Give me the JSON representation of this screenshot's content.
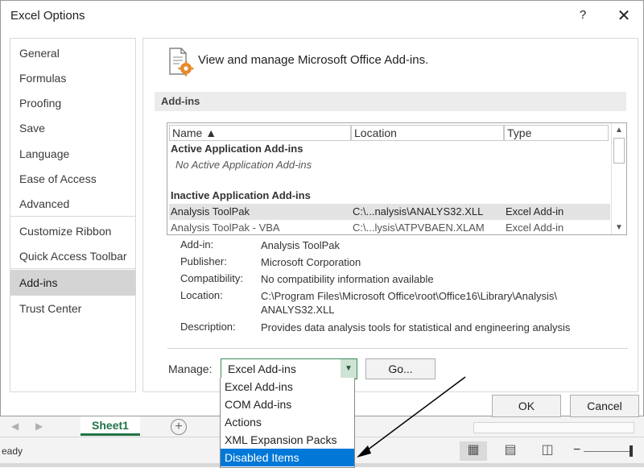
{
  "window": {
    "title": "Excel Options",
    "help": "?",
    "close": "✕"
  },
  "sidebar": {
    "items": [
      {
        "label": "General"
      },
      {
        "label": "Formulas"
      },
      {
        "label": "Proofing"
      },
      {
        "label": "Save"
      },
      {
        "label": "Language"
      },
      {
        "label": "Ease of Access"
      },
      {
        "label": "Advanced"
      },
      {
        "label": "Customize Ribbon"
      },
      {
        "label": "Quick Access Toolbar"
      },
      {
        "label": "Add-ins"
      },
      {
        "label": "Trust Center"
      }
    ],
    "selected": "Add-ins"
  },
  "main": {
    "header_text": "View and manage Microsoft Office Add-ins.",
    "section_title": "Add-ins",
    "columns": {
      "name": "Name ▲",
      "location": "Location",
      "type": "Type"
    },
    "groups": {
      "active_title": "Active Application Add-ins",
      "active_empty": "No Active Application Add-ins",
      "inactive_title": "Inactive Application Add-ins"
    },
    "rows": [
      {
        "name": "Analysis ToolPak",
        "location": "C:\\...nalysis\\ANALYS32.XLL",
        "type": "Excel Add-in"
      },
      {
        "name": "Analysis ToolPak - VBA",
        "location": "C:\\...lysis\\ATPVBAEN.XLAM",
        "type": "Excel Add-in"
      }
    ],
    "details": {
      "addin_label": "Add-in:",
      "addin_value": "Analysis ToolPak",
      "publisher_label": "Publisher:",
      "publisher_value": "Microsoft Corporation",
      "compat_label": "Compatibility:",
      "compat_value": "No compatibility information available",
      "location_label": "Location:",
      "location_value_1": "C:\\Program Files\\Microsoft Office\\root\\Office16\\Library\\Analysis\\",
      "location_value_2": "ANALYS32.XLL",
      "description_label": "Description:",
      "description_value": "Provides data analysis tools for statistical and engineering analysis"
    },
    "manage": {
      "label": "Manage:",
      "selected": "Excel Add-ins",
      "go_label": "Go...",
      "options": [
        "Excel Add-ins",
        "COM Add-ins",
        "Actions",
        "XML Expansion Packs",
        "Disabled Items"
      ],
      "highlighted": "Disabled Items"
    }
  },
  "footer": {
    "ok_label": "OK",
    "cancel_label": "Cancel"
  },
  "excel": {
    "sheet_tab": "Sheet1",
    "add_sheet": "+",
    "status_text": "eady"
  },
  "colors": {
    "accent_green": "#217346",
    "selection_blue": "#0078d7",
    "nav_selected": "#d4d4d4"
  }
}
